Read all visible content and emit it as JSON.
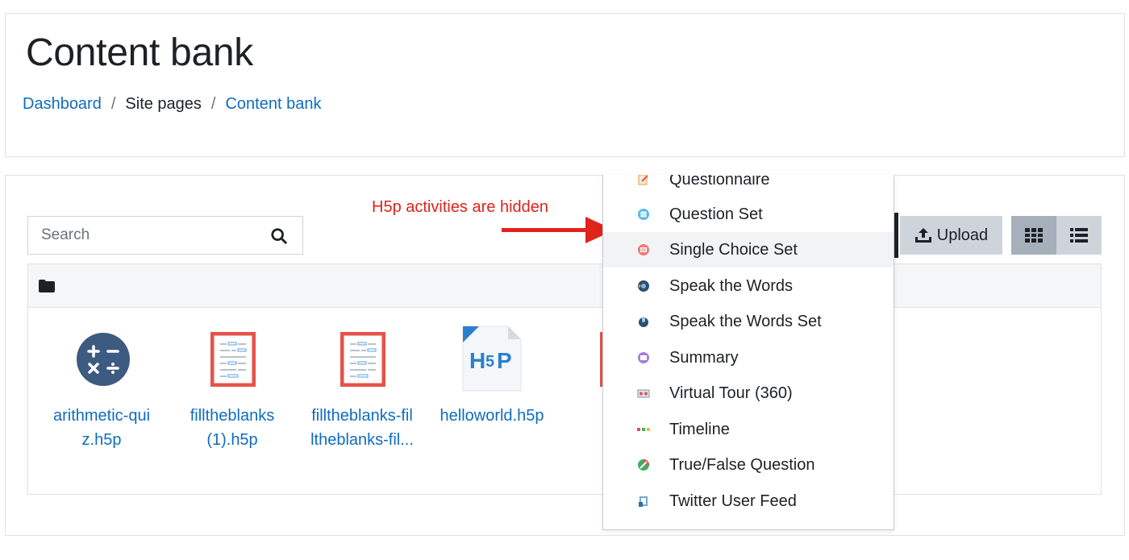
{
  "header": {
    "title": "Content bank",
    "breadcrumb": [
      {
        "label": "Dashboard",
        "link": true
      },
      {
        "label": "Site pages",
        "link": false
      },
      {
        "label": "Content bank",
        "link": true
      }
    ]
  },
  "search": {
    "placeholder": "Search"
  },
  "annotation": {
    "text": "H5p activities are hidden",
    "color": "#e0231b"
  },
  "toolbar": {
    "upload_label": "Upload"
  },
  "files": [
    {
      "name_line1": "arithmetic-qui",
      "name_line2": "z.h5p",
      "icon": "calculator-icon"
    },
    {
      "name_line1": "filltheblanks",
      "name_line2": "(1).h5p",
      "icon": "fill-blanks-icon"
    },
    {
      "name_line1": "filltheblanks-fil",
      "name_line2": "ltheblanks-fil...",
      "icon": "fill-blanks-icon"
    },
    {
      "name_line1": "helloworld.h5p",
      "name_line2": "",
      "icon": "h5p-file-icon"
    }
  ],
  "dropdown": {
    "items": [
      {
        "label": "Questionnaire",
        "icon": "questionnaire-icon"
      },
      {
        "label": "Question Set",
        "icon": "question-set-icon"
      },
      {
        "label": "Single Choice Set",
        "icon": "single-choice-icon",
        "active": true
      },
      {
        "label": "Speak the Words",
        "icon": "speak-words-icon"
      },
      {
        "label": "Speak the Words Set",
        "icon": "speak-words-set-icon"
      },
      {
        "label": "Summary",
        "icon": "summary-icon"
      },
      {
        "label": "Virtual Tour (360)",
        "icon": "virtual-tour-icon"
      },
      {
        "label": "Timeline",
        "icon": "timeline-icon"
      },
      {
        "label": "True/False Question",
        "icon": "true-false-icon"
      },
      {
        "label": "Twitter User Feed",
        "icon": "twitter-feed-icon"
      }
    ]
  },
  "colors": {
    "link": "#0f6cbf",
    "text": "#1d2125",
    "button_bg": "#ced4da",
    "button_active_bg": "#a6b0ba",
    "fill_blanks_red": "#e5534b",
    "calculator_blue": "#3d5a80"
  }
}
